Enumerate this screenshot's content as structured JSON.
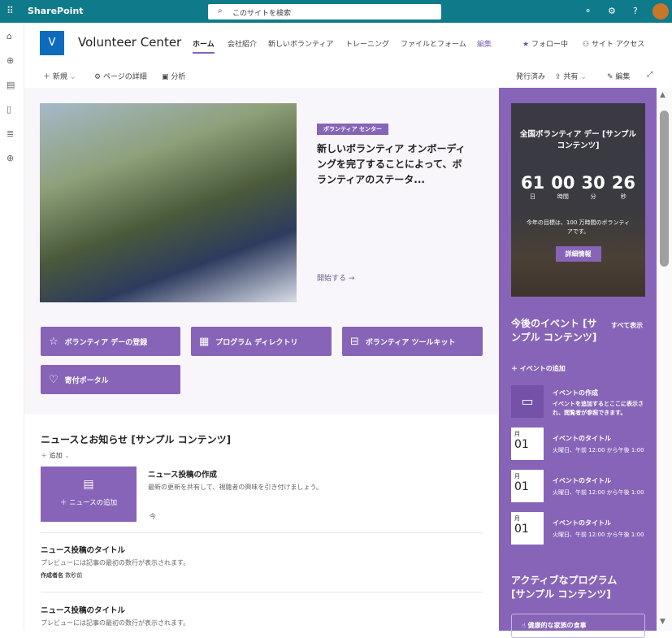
{
  "topbar": {
    "app": "SharePoint",
    "search_placeholder": "このサイトを検索"
  },
  "site": {
    "logo_letter": "V",
    "title": "Volunteer Center",
    "nav": [
      "ホーム",
      "会社紹介",
      "新しいボランティア",
      "トレーニング",
      "ファイルとフォーム",
      "編集"
    ],
    "follow": "フォロー中",
    "access": "サイト アクセス"
  },
  "command": {
    "new": "新規",
    "details": "ページの詳細",
    "analytics": "分析",
    "published": "発行済み",
    "share": "共有",
    "edit": "編集"
  },
  "hero": {
    "tag": "ボランティア センター",
    "title": "新しいボランティア オンボーディングを完了することによって、ボランティアのステータ...",
    "link": "開始する"
  },
  "quicklinks": [
    "ボランティア デーの登録",
    "プログラム ディレクトリ",
    "ボランティア ツールキット",
    "寄付ポータル"
  ],
  "news": {
    "heading": "ニュースとお知らせ [サンプル コンテンツ]",
    "add": "追加",
    "add_news": "ニュースの追加",
    "create_title": "ニュース投稿の作成",
    "create_desc": "最新の更新を共有して、視聴者の興味を引き付けましょう。",
    "create_time": "今",
    "posts": [
      {
        "title": "ニュース投稿のタイトル",
        "desc": "プレビューには記事の最初の数行が表示されます。",
        "author": "作成者名",
        "time": "数秒前"
      },
      {
        "title": "ニュース投稿のタイトル",
        "desc": "プレビューには記事の最初の数行が表示されます。"
      }
    ]
  },
  "countdown": {
    "title": "全国ボランティア デー [サンプル コンテンツ]",
    "days": "61",
    "hours": "00",
    "minutes": "30",
    "seconds": "26",
    "l_days": "日",
    "l_hours": "時間",
    "l_minutes": "分",
    "l_seconds": "秒",
    "goal": "今年の目標は、100 万時間のボランティアです。",
    "button": "詳細情報"
  },
  "events": {
    "heading": "今後のイベント [サンプル コンテンツ]",
    "see_all": "すべて表示",
    "add": "イベントの追加",
    "create_title": "イベントの作成",
    "create_desc": "イベントを追加するとここに表示され、閲覧者が参照できます。",
    "items": [
      {
        "month": "月",
        "day": "01",
        "title": "イベントのタイトル",
        "time": "火曜日、午前 12:00 から午後 1:00"
      },
      {
        "month": "月",
        "day": "01",
        "title": "イベントのタイトル",
        "time": "火曜日、午前 12:00 から午後 1:00"
      },
      {
        "month": "月",
        "day": "01",
        "title": "イベントのタイトル",
        "time": "火曜日、午前 12:00 から午後 1:00"
      }
    ]
  },
  "programs": {
    "heading": "アクティブなプログラム [サンプル コンテンツ]",
    "first": "健康的な家族の食事"
  },
  "colors": {
    "accent": "#8764b8",
    "topbar": "#0f7b8a"
  }
}
